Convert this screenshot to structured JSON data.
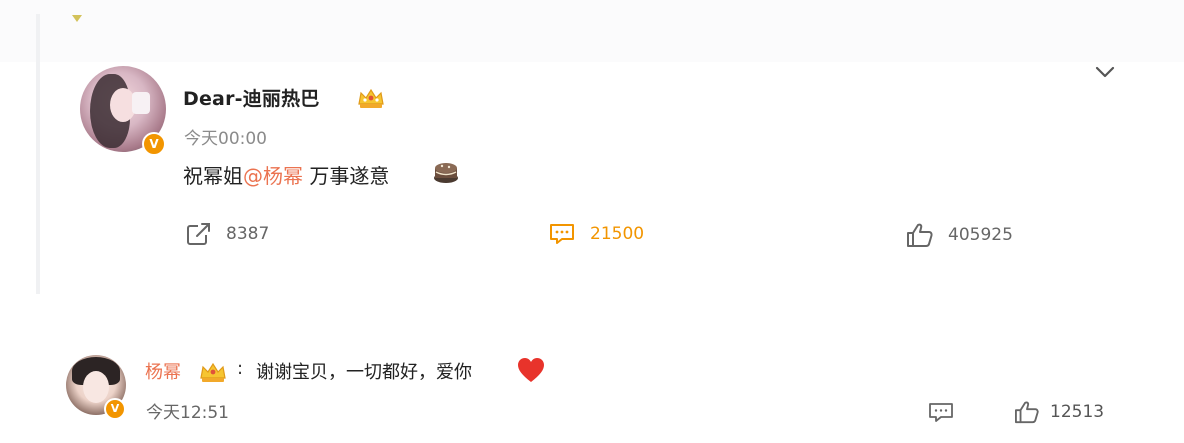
{
  "post": {
    "username": "Dear-迪丽热巴",
    "timestamp": "今天00:00",
    "text_prefix": "祝幂姐",
    "mention": "@杨幂",
    "text_suffix": " 万事遂意",
    "icons": {
      "verified": "verified-v-icon",
      "crown": "crown-icon",
      "emoji": "cake-emoji-icon",
      "expand": "chevron-down-icon"
    },
    "verified_label": "V"
  },
  "actions": {
    "repost_count": "8387",
    "comment_count": "21500",
    "like_count": "405925",
    "comment_active_color": "#f29500"
  },
  "reply": {
    "username": "杨幂",
    "colon": ":",
    "text": "谢谢宝贝，一切都好，爱你",
    "timestamp": "今天12:51",
    "like_count": "12513",
    "verified_label": "V",
    "icons": {
      "emoji": "heart-emoji-icon",
      "comment": "comment-icon",
      "like": "thumbs-up-icon"
    }
  },
  "colors": {
    "mention": "#eb7350",
    "verified_badge": "#f29500",
    "heart": "#e8332b"
  }
}
